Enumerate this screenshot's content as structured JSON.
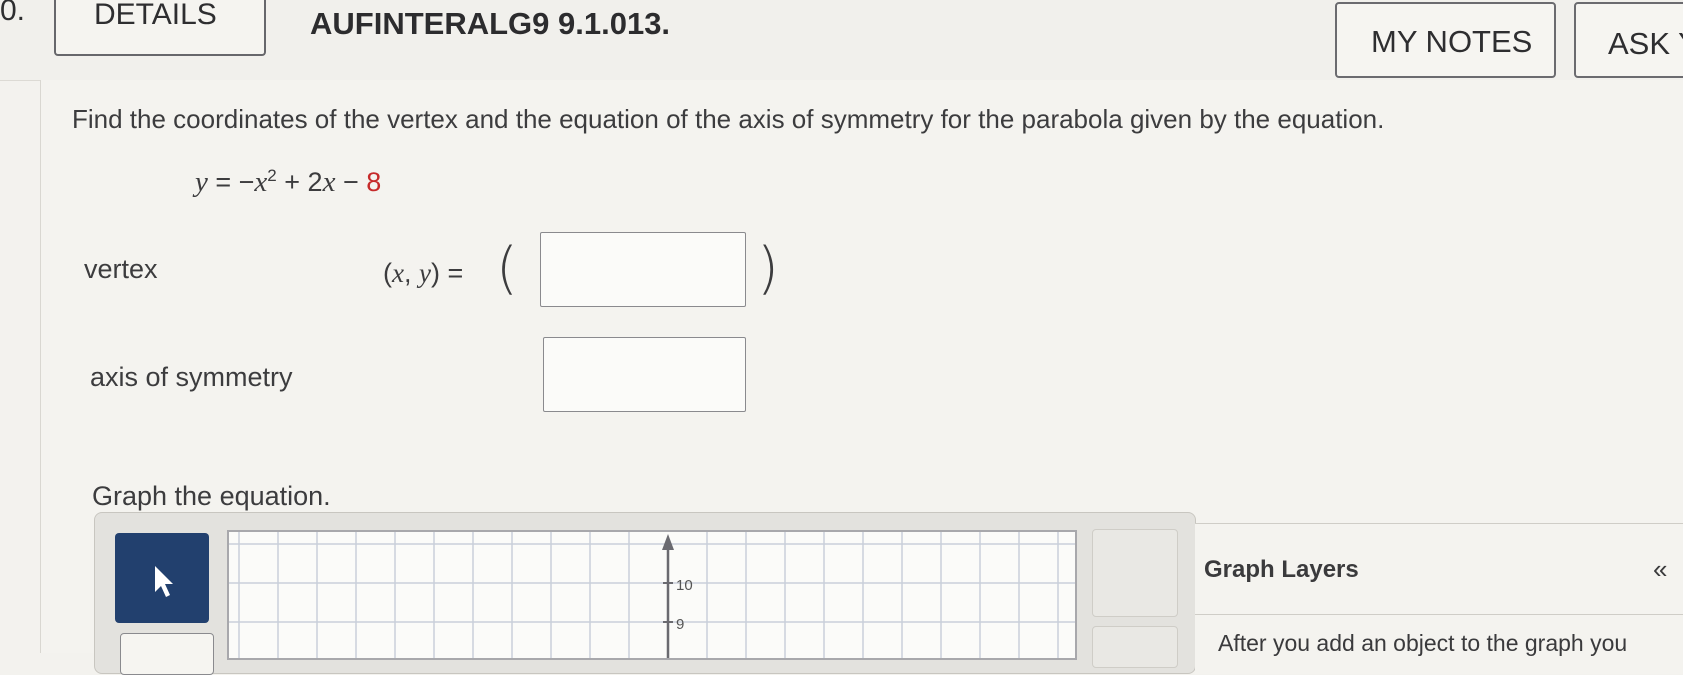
{
  "header": {
    "question_number": "0.",
    "details_label": "DETAILS",
    "question_id": "AUFINTERALG9 9.1.013.",
    "my_notes_label": "MY NOTES",
    "ask_label": "ASK Y"
  },
  "question": {
    "prompt": "Find the coordinates of the vertex and the equation of the axis of symmetry for the parabola given by the equation.",
    "equation": {
      "lhs": "y",
      "eq": " = −",
      "x": "x",
      "exp": "2",
      "mid": " + 2",
      "x2": "x",
      "minus": " − ",
      "const": "8"
    },
    "vertex_label": "vertex",
    "xy_x": "x",
    "xy_y": "y",
    "xy_eq": " =",
    "vertex_value": "",
    "axis_label": "axis of symmetry",
    "axis_value": "",
    "graph_prompt": "Graph the equation."
  },
  "graph": {
    "y_ticks": [
      "10",
      "9"
    ],
    "layers_title": "Graph Layers",
    "collapse_icon": "«",
    "layers_hint": "After you add an object to the graph you"
  },
  "colors": {
    "tool_active": "#22406e",
    "equation_constant": "#c62a2a"
  }
}
